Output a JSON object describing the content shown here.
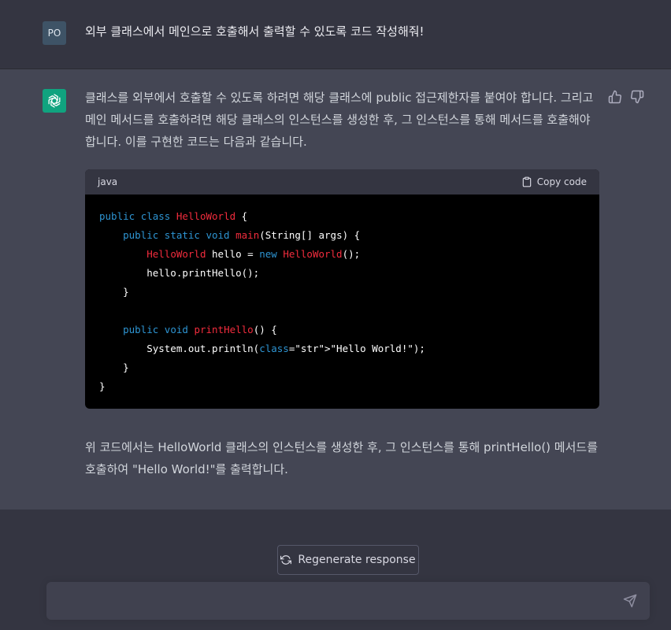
{
  "user_message": {
    "avatar_text": "PO",
    "text": "외부 클래스에서 메인으로 호출해서 출력할 수 있도록 코드 작성해줘!"
  },
  "assistant_message": {
    "intro": "클래스를 외부에서 호출할 수 있도록 하려면 해당 클래스에 public 접근제한자를 붙여야 합니다. 그리고 메인 메서드를 호출하려면 해당 클래스의 인스턴스를 생성한 후, 그 인스턴스를 통해 메서드를 호출해야 합니다. 이를 구현한 코드는 다음과 같습니다.",
    "code_language": "java",
    "copy_label": "Copy code",
    "code_lines": [
      "public class HelloWorld {",
      "    public static void main(String[] args) {",
      "        HelloWorld hello = new HelloWorld();",
      "        hello.printHello();",
      "    }",
      "",
      "    public void printHello() {",
      "        System.out.println(\"Hello World!\");",
      "    }",
      "}"
    ],
    "summary": "위 코드에서는 HelloWorld 클래스의 인스턴스를 생성한 후, 그 인스턴스를 통해 printHello() 메서드를 호출하여 \"Hello World!\"를 출력합니다."
  },
  "composer": {
    "regenerate_label": "Regenerate response",
    "input_value": ""
  },
  "icons": {
    "user_avatar": "user-avatar-icon",
    "bot_avatar": "openai-logo-icon",
    "thumbs_up": "thumbs-up-icon",
    "thumbs_down": "thumbs-down-icon",
    "clipboard": "clipboard-icon",
    "regenerate": "refresh-icon",
    "send": "send-icon"
  },
  "colors": {
    "background": "#343541",
    "assistant_background": "#444654",
    "accent": "#10a37f",
    "code_keyword": "#2e95d3",
    "code_class": "#f22c3d",
    "code_string": "#00a67d"
  }
}
